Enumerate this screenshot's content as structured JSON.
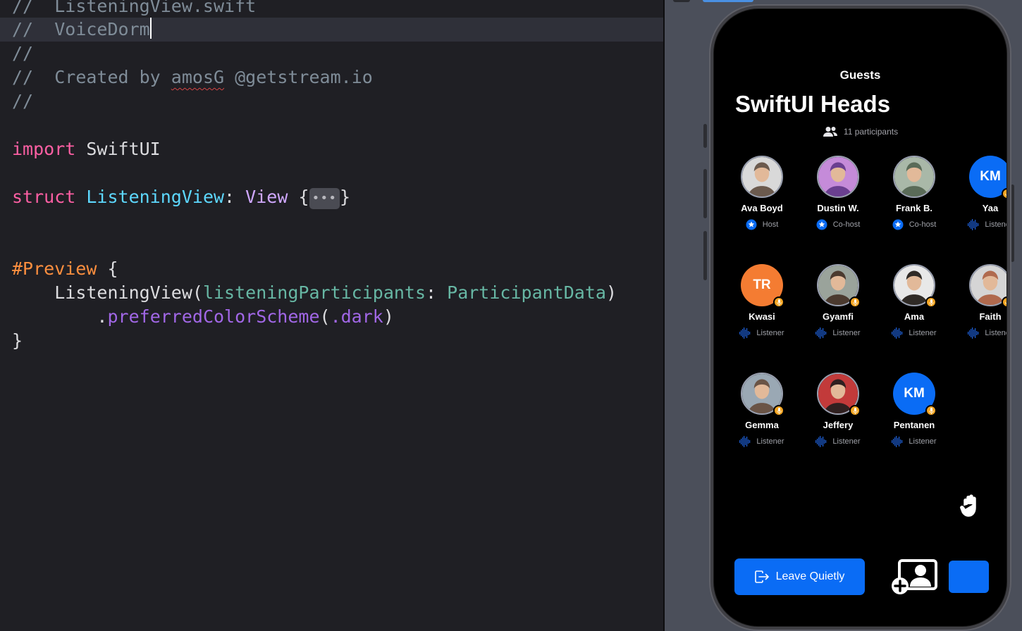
{
  "editor": {
    "lines": {
      "l1": {
        "slashes": "//",
        "text": "ListeningView.swift"
      },
      "l2": {
        "slashes": "//",
        "text": "VoiceDorm"
      },
      "l3": {
        "slashes": "//"
      },
      "l4": {
        "slashes": "//",
        "created": "Created by",
        "author": "amosG",
        "email": "@getstream.io"
      },
      "l5": {
        "slashes": "//"
      },
      "l7": {
        "kw": "import",
        "module": "SwiftUI"
      },
      "l9": {
        "kw": "struct",
        "name": "ListeningView",
        "colon": ":",
        "proto": "View",
        "open": "{",
        "fold": "•••",
        "close": "}"
      },
      "l12": {
        "macro": "#Preview",
        "open": "{"
      },
      "l13": {
        "call": "ListeningView",
        "lp": "(",
        "param": "listeningParticipants",
        "colon": ":",
        "arg": "ParticipantData",
        "rp": ")"
      },
      "l14": {
        "dot": ".",
        "method": "preferredColorScheme",
        "lp": "(",
        "value": ".dark",
        "rp": ")"
      },
      "l15": {
        "close": "}"
      }
    }
  },
  "preview": {
    "nav_title": "Guests",
    "room_title": "SwiftUI Heads",
    "participants_count": "11 participants",
    "participants": [
      {
        "name": "Ava Boyd",
        "role": "Host",
        "avatar": "photo",
        "role_icon": "star-badge-icon"
      },
      {
        "name": "Dustin W.",
        "role": "Co-host",
        "avatar": "photo",
        "role_icon": "star-badge-icon"
      },
      {
        "name": "Frank B.",
        "role": "Co-host",
        "avatar": "photo",
        "role_icon": "star-badge-icon"
      },
      {
        "name": "Yaa",
        "role": "Listener",
        "avatar": "initials",
        "initials": "KM",
        "color": "#0a6cf5",
        "role_icon": "waveform-icon"
      },
      {
        "name": "Kwasi",
        "role": "Listener",
        "avatar": "initials",
        "initials": "TR",
        "color": "#f47c32",
        "role_icon": "waveform-icon"
      },
      {
        "name": "Gyamfi",
        "role": "Listener",
        "avatar": "photo",
        "role_icon": "waveform-icon"
      },
      {
        "name": "Ama",
        "role": "Listener",
        "avatar": "photo",
        "role_icon": "waveform-icon"
      },
      {
        "name": "Faith",
        "role": "Listener",
        "avatar": "photo",
        "role_icon": "waveform-icon"
      },
      {
        "name": "Gemma",
        "role": "Listener",
        "avatar": "photo",
        "role_icon": "waveform-icon"
      },
      {
        "name": "Jeffery",
        "role": "Listener",
        "avatar": "photo",
        "role_icon": "waveform-icon"
      },
      {
        "name": "Pentanen",
        "role": "Listener",
        "avatar": "initials",
        "initials": "KM",
        "color": "#0a6cf5",
        "role_icon": "waveform-icon"
      }
    ],
    "leave_label": "Leave Quietly",
    "colors": {
      "accent": "#0a6cf5",
      "mic_badge": "#f5a623",
      "background": "#000000"
    }
  }
}
